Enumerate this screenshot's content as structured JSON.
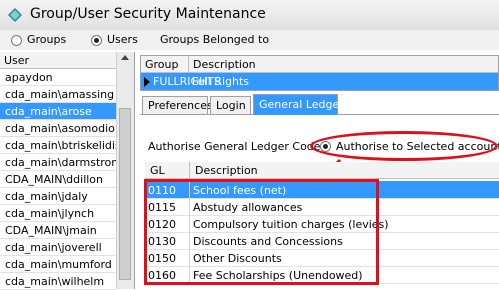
{
  "window": {
    "title": "Group/User Security Maintenance"
  },
  "mode": {
    "groups_label": "Groups",
    "users_label": "Users",
    "groups_belonged_label": "Groups Belonged to",
    "selected": "users"
  },
  "users": {
    "header": "User",
    "items": [
      "apaydon",
      "cda_main\\amassing",
      "cda_main\\arose",
      "cda_main\\asomodio",
      "cda_main\\btriskelidis",
      "cda_main\\darmstrong",
      "CDA_MAIN\\ddillon",
      "cda_main\\jdaly",
      "cda_main\\jlynch",
      "CDA_MAIN\\jmain",
      "cda_main\\joverell",
      "cda_main\\mumford",
      "cda_main\\wilhelm"
    ],
    "selected_index": 2
  },
  "groups": {
    "headers": [
      "Group",
      "Description"
    ],
    "rows": [
      {
        "group": "FULLRIGHTS",
        "description": "Full Rights"
      }
    ]
  },
  "tabs": {
    "preferences": "Preferences",
    "login": "Login",
    "general_ledger": "General Ledger",
    "active": "general_ledger"
  },
  "gl": {
    "authorise_label": "Authorise General Ledger Codes:",
    "radio_label": "Authorise to Selected accounts",
    "headers": [
      "GL Code",
      "Description"
    ],
    "rows": [
      {
        "code": "0110",
        "description": "School fees (net)"
      },
      {
        "code": "0115",
        "description": "Abstudy allowances"
      },
      {
        "code": "0120",
        "description": "Compulsory tuition charges (levies)"
      },
      {
        "code": "0130",
        "description": "Discounts and Concessions"
      },
      {
        "code": "0150",
        "description": "Other Discounts"
      },
      {
        "code": "0160",
        "description": "Fee Scholarships (Unendowed)"
      }
    ],
    "selected_index": 0
  },
  "colors": {
    "selection": "#3399ff",
    "annotation": "#e0101a"
  }
}
